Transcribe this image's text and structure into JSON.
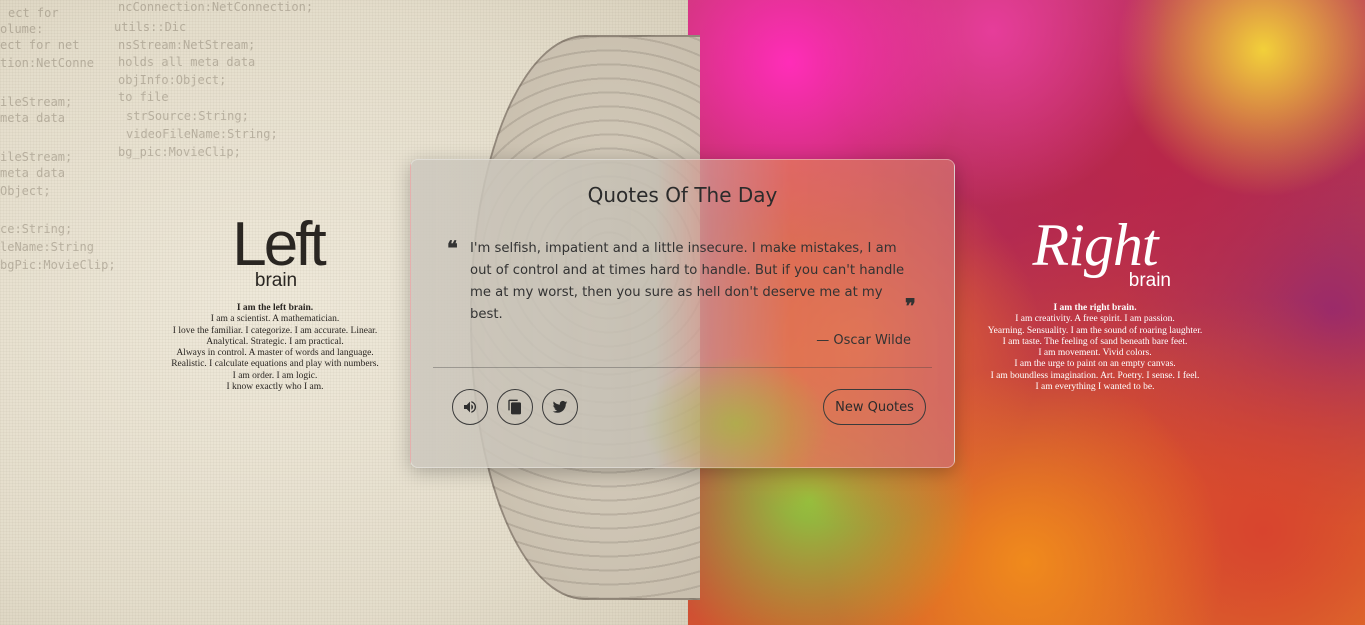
{
  "card": {
    "title": "Quotes Of The Day",
    "quote": "I'm selfish, impatient and a little insecure. I make mistakes, I am out of control and at times hard to handle. But if you can't handle me at my worst, then you sure as hell don't deserve me at my best.",
    "author": "— Oscar Wilde",
    "new_quote_label": "New Quotes",
    "open_quote_mark": "❝",
    "close_quote_mark": "❞"
  },
  "left_brain": {
    "title": "Left",
    "subtitle": "brain",
    "lines": [
      "I am the left brain.",
      "I am a scientist. A mathematician.",
      "I love the familiar. I categorize. I am accurate. Linear.",
      "Analytical. Strategic. I am practical.",
      "Always in control. A master of words and language.",
      "Realistic. I calculate equations and play with numbers.",
      "I am order. I am logic.",
      "I know exactly who I am."
    ]
  },
  "right_brain": {
    "title": "Right",
    "subtitle": "brain",
    "lines": [
      "I am the right brain.",
      "I am creativity. A free spirit. I am passion.",
      "Yearning. Sensuality. I am the sound of roaring laughter.",
      "I am taste. The feeling of sand beneath bare feet.",
      "I am movement. Vivid colors.",
      "I am the urge to paint on an empty canvas.",
      "I am boundless imagination. Art. Poetry. I sense. I feel.",
      "I am everything I wanted to be."
    ]
  },
  "background_code": [
    "ect for",
    "olume:",
    "ect for net",
    "tion:NetConne",
    "ileStream;",
    "meta data",
    "ileStream;",
    "meta data",
    "Object;",
    "ce:String;",
    "leName:String",
    "bgPic:MovieClip;",
    "ncConnection:NetConnection;",
    "utils::Dic",
    "nsStream:NetStream;",
    "holds all meta data",
    "objInfo:Object;",
    "to file",
    "strSource:String;",
    "videoFileName:String;",
    "bg_pic:MovieClip;"
  ],
  "icons": {
    "speak": "volume-icon",
    "copy": "copy-icon",
    "tweet": "twitter-icon"
  },
  "colors": {
    "text_dark": "#2b2b2b",
    "button_border": "#3a3a3a",
    "right_caption": "#ffffff"
  }
}
